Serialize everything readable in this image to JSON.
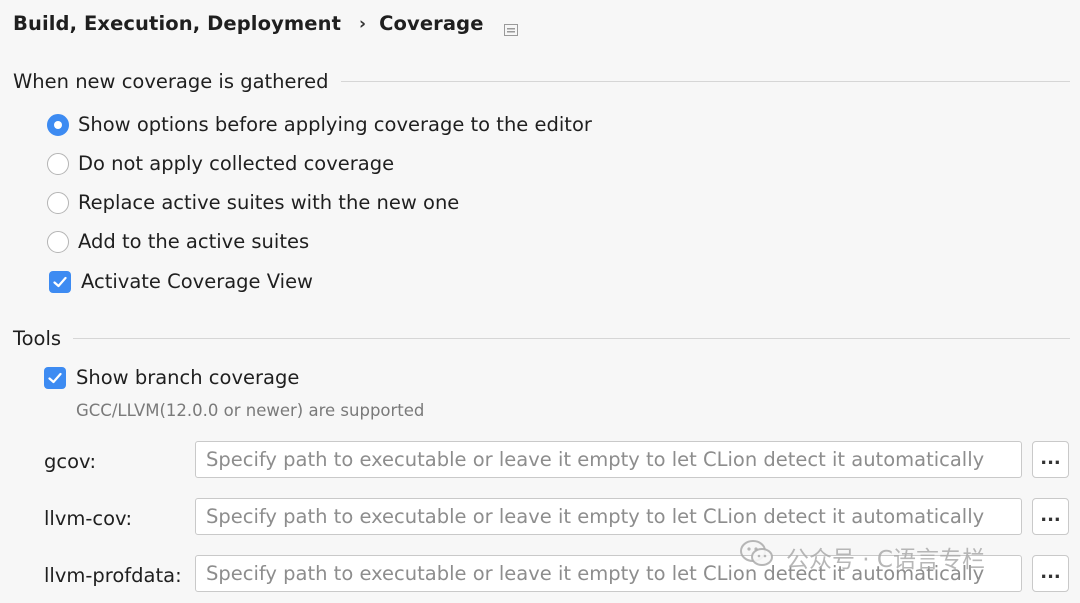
{
  "breadcrumb": {
    "parent": "Build, Execution, Deployment",
    "separator": "›",
    "current": "Coverage",
    "pin_icon": "layout-icon"
  },
  "coverage_section": {
    "title": "When new coverage is gathered",
    "options": [
      {
        "label": "Show options before applying coverage to the editor",
        "selected": true
      },
      {
        "label": "Do not apply collected coverage",
        "selected": false
      },
      {
        "label": "Replace active suites with the new one",
        "selected": false
      },
      {
        "label": "Add to the active suites",
        "selected": false
      }
    ],
    "activate_view": {
      "label": "Activate Coverage View",
      "checked": true
    }
  },
  "tools_section": {
    "title": "Tools",
    "branch_coverage": {
      "label": "Show branch coverage",
      "checked": true
    },
    "hint": "GCC/LLVM(12.0.0 or newer) are supported",
    "fields": [
      {
        "label": "gcov:",
        "placeholder": "Specify path to executable or leave it empty to let CLion detect it automatically",
        "browse": "..."
      },
      {
        "label": "llvm-cov:",
        "placeholder": "Specify path to executable or leave it empty to let CLion detect it automatically",
        "browse": "..."
      },
      {
        "label": "llvm-profdata:",
        "placeholder": "Specify path to executable or leave it empty to let CLion detect it automatically",
        "browse": "..."
      }
    ]
  },
  "watermark": {
    "text": "公众号 · C语言专栏",
    "icon": "wechat-icon"
  },
  "colors": {
    "accent": "#3d8bf2",
    "background": "#f7f7f7",
    "hint": "#7a7a7a"
  }
}
